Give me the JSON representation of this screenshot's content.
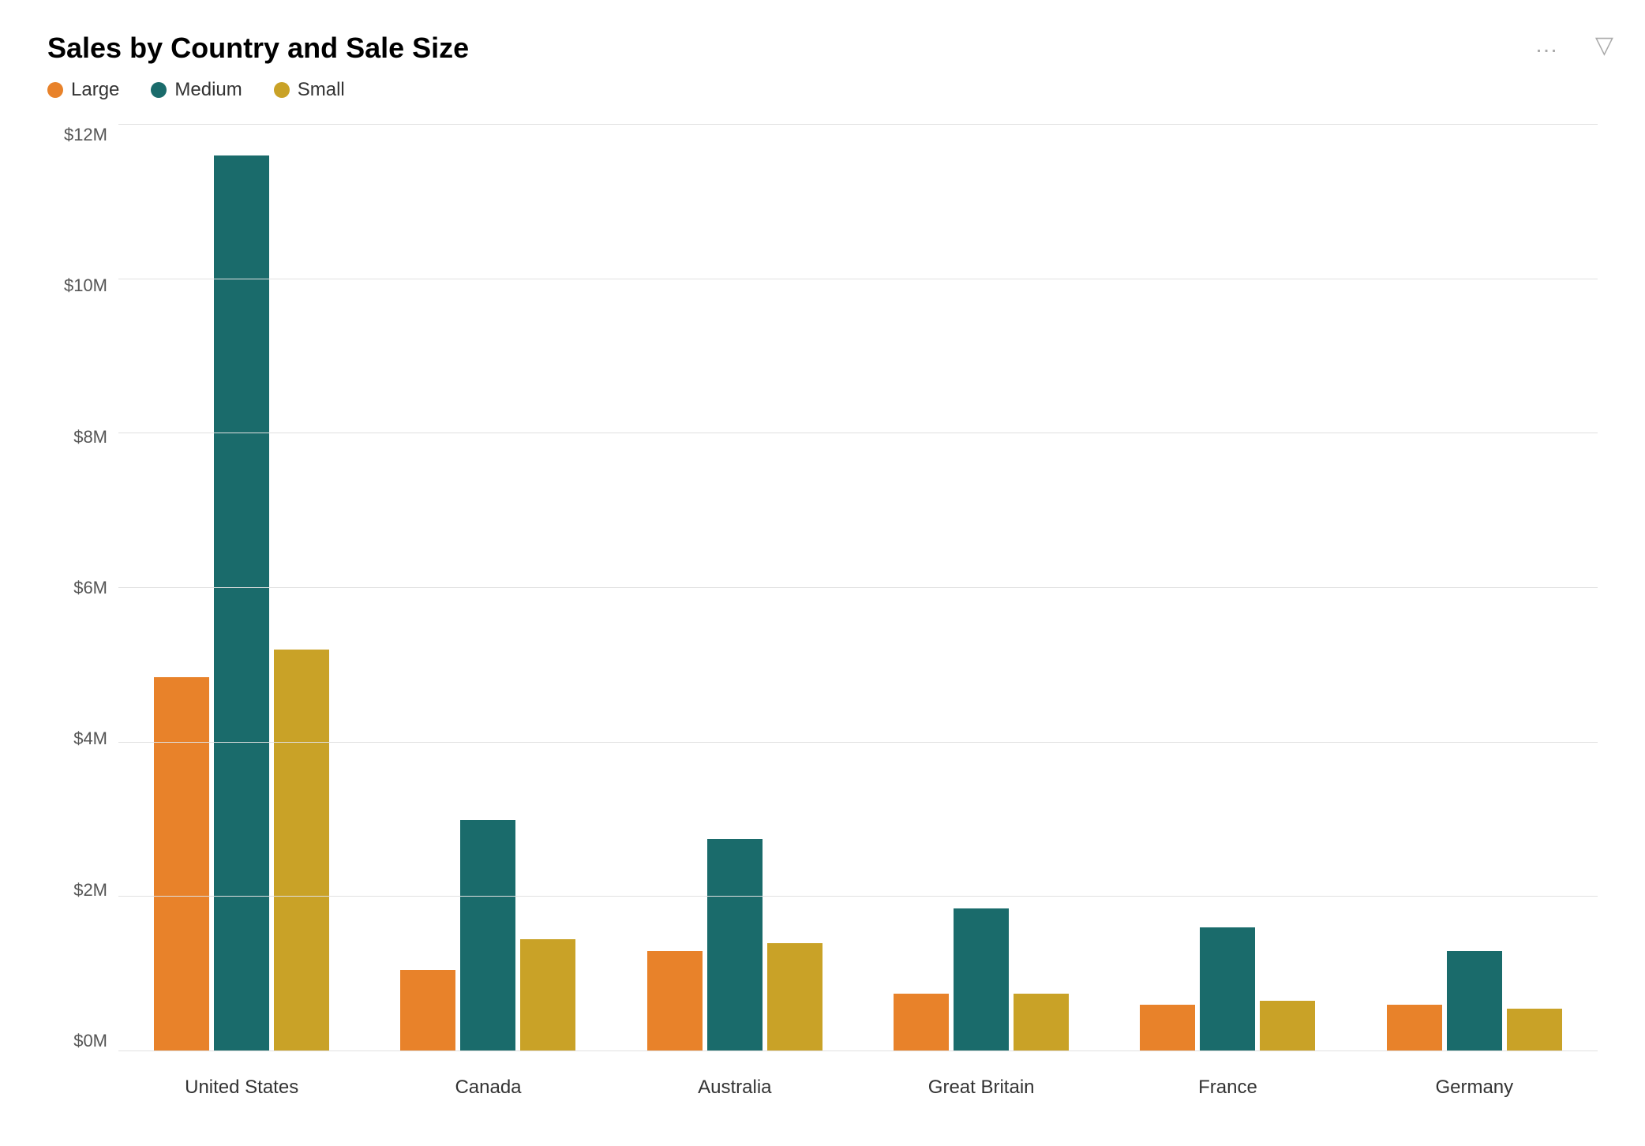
{
  "title": "Sales by Country and Sale Size",
  "legend": [
    {
      "label": "Large",
      "color": "#E8822A"
    },
    {
      "label": "Medium",
      "color": "#1A6B6B"
    },
    {
      "label": "Small",
      "color": "#C9A227"
    }
  ],
  "yAxis": {
    "labels": [
      "$0M",
      "$2M",
      "$4M",
      "$6M",
      "$8M",
      "$10M",
      "$12M"
    ],
    "max": 12
  },
  "countries": [
    {
      "name": "United States",
      "large": 4.85,
      "medium": 11.6,
      "small": 5.2
    },
    {
      "name": "Canada",
      "large": 1.05,
      "medium": 3.0,
      "small": 1.45
    },
    {
      "name": "Australia",
      "large": 1.3,
      "medium": 2.75,
      "small": 1.4
    },
    {
      "name": "Great Britain",
      "large": 0.75,
      "medium": 1.85,
      "small": 0.75
    },
    {
      "name": "France",
      "large": 0.6,
      "medium": 1.6,
      "small": 0.65
    },
    {
      "name": "Germany",
      "large": 0.6,
      "medium": 1.3,
      "small": 0.55
    }
  ],
  "colors": {
    "large": "#E8822A",
    "medium": "#1A6B6B",
    "small": "#C9A227"
  },
  "icons": {
    "filter": "▽",
    "ellipsis": "…"
  }
}
